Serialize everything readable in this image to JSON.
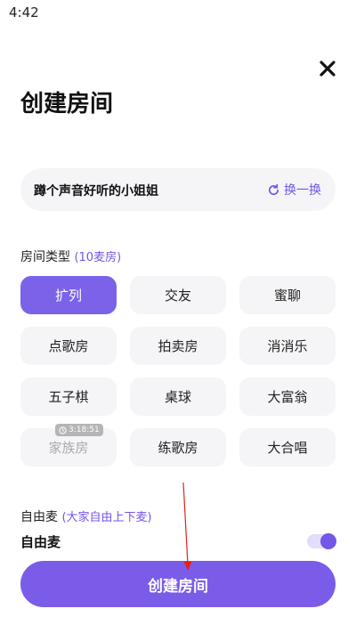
{
  "status_bar": {
    "time": "4:42"
  },
  "header": {
    "title": "创建房间"
  },
  "room_name": {
    "value": "蹲个声音好听的小姐姐",
    "refresh_label": "换一换"
  },
  "room_type": {
    "label": "房间类型",
    "sub_label": "(10麦房)",
    "items": [
      {
        "label": "扩列",
        "state": "selected"
      },
      {
        "label": "交友",
        "state": "normal"
      },
      {
        "label": "蜜聊",
        "state": "normal"
      },
      {
        "label": "点歌房",
        "state": "normal"
      },
      {
        "label": "拍卖房",
        "state": "normal"
      },
      {
        "label": "消消乐",
        "state": "normal"
      },
      {
        "label": "五子棋",
        "state": "normal"
      },
      {
        "label": "桌球",
        "state": "normal"
      },
      {
        "label": "大富翁",
        "state": "normal"
      },
      {
        "label": "家族房",
        "state": "disabled"
      },
      {
        "label": "练歌房",
        "state": "normal"
      },
      {
        "label": "大合唱",
        "state": "normal"
      }
    ],
    "timer_badge": "3:18:51"
  },
  "free_mic": {
    "label": "自由麦",
    "sub_label": "(大家自由上下麦)",
    "row_label": "自由麦",
    "enabled": true
  },
  "create_button": {
    "label": "创建房间"
  },
  "colors": {
    "accent": "#7456e8",
    "primary_button": "#7b5ce9",
    "annotation_arrow": "#e02020"
  }
}
